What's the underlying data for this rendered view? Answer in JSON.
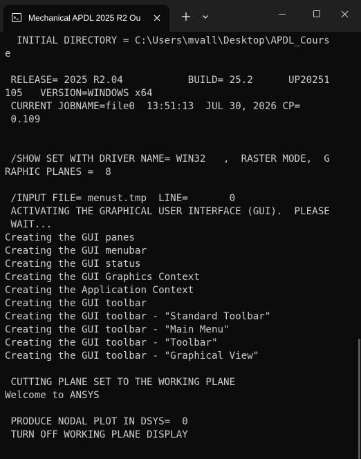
{
  "window": {
    "tab_title": "Mechanical APDL 2025 R2 Ou",
    "tab_icon": "terminal-icon",
    "close_tab_icon": "close-icon",
    "new_tab_icon": "plus-icon",
    "dropdown_icon": "chevron-down-icon",
    "minimize_icon": "minimize-icon",
    "maximize_icon": "maximize-icon",
    "close_window_icon": "close-icon"
  },
  "colors": {
    "background": "#0c0c0c",
    "titlebar": "#202020",
    "text": "#cccccc"
  },
  "terminal": {
    "lines": [
      "  INITIAL DIRECTORY = C:\\Users\\mvall\\Desktop\\APDL_Cours",
      "e",
      "",
      " RELEASE= 2025 R2.04           BUILD= 25.2      UP20251",
      "105   VERSION=WINDOWS x64",
      " CURRENT JOBNAME=file0  13:51:13  JUL 30, 2026 CP=",
      " 0.109",
      "",
      "",
      " /SHOW SET WITH DRIVER NAME= WIN32   ,  RASTER MODE,  G",
      "RAPHIC PLANES =  8",
      "",
      " /INPUT FILE= menust.tmp  LINE=       0",
      " ACTIVATING THE GRAPHICAL USER INTERFACE (GUI).  PLEASE",
      " WAIT...",
      "Creating the GUI panes",
      "Creating the GUI menubar",
      "Creating the GUI status",
      "Creating the GUI Graphics Context",
      "Creating the Application Context",
      "Creating the GUI toolbar",
      "Creating the GUI toolbar - \"Standard Toolbar\"",
      "Creating the GUI toolbar - \"Main Menu\"",
      "Creating the GUI toolbar - \"Toolbar\"",
      "Creating the GUI toolbar - \"Graphical View\"",
      "",
      " CUTTING PLANE SET TO THE WORKING PLANE",
      "Welcome to ANSYS",
      "",
      " PRODUCE NODAL PLOT IN DSYS=  0",
      " TURN OFF WORKING PLANE DISPLAY"
    ]
  }
}
